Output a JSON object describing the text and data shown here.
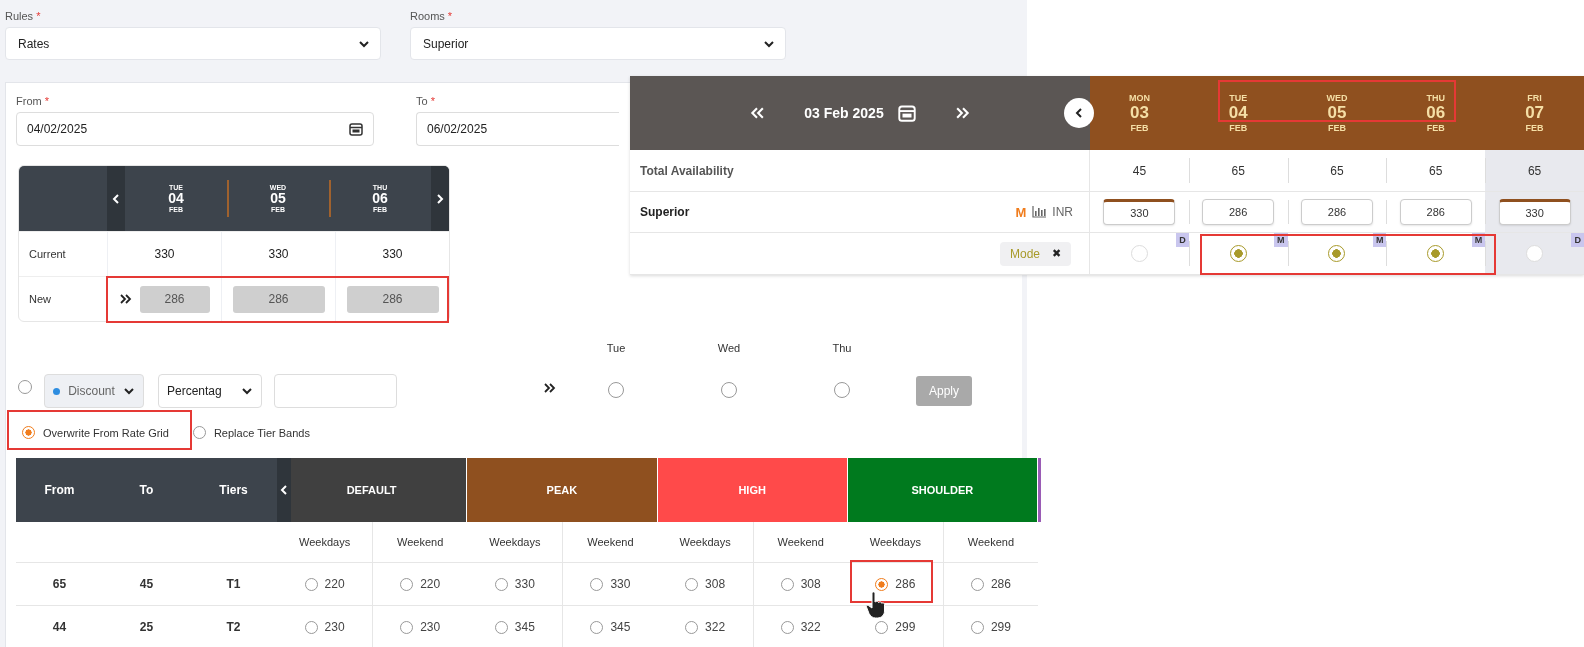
{
  "rules": {
    "label": "Rules",
    "required_mark": "*",
    "value": "Rates"
  },
  "rooms": {
    "label": "Rooms",
    "required_mark": "*",
    "value": "Superior"
  },
  "from": {
    "label": "From",
    "required_mark": "*",
    "value": "04/02/2025"
  },
  "to": {
    "label": "To",
    "required_mark": "*",
    "value": "06/02/2025"
  },
  "mini_grid": {
    "days": [
      {
        "dow": "TUE",
        "day": "04",
        "month": "FEB"
      },
      {
        "dow": "WED",
        "day": "05",
        "month": "FEB"
      },
      {
        "dow": "THU",
        "day": "06",
        "month": "FEB"
      }
    ],
    "current": {
      "label": "Current",
      "values": [
        "330",
        "330",
        "330"
      ]
    },
    "new": {
      "label": "New",
      "values": [
        "286",
        "286",
        "286"
      ]
    }
  },
  "adjust": {
    "selected": false,
    "type": "Discount",
    "method": "Percentag",
    "days": [
      {
        "label": "Tue",
        "selected": false
      },
      {
        "label": "Wed",
        "selected": false
      },
      {
        "label": "Thu",
        "selected": false
      }
    ],
    "apply": "Apply"
  },
  "modes": [
    {
      "label": "Overwrite From Rate Grid",
      "selected": true
    },
    {
      "label": "Replace Tier Bands",
      "selected": false
    }
  ],
  "tier_table": {
    "columns": [
      "From",
      "To",
      "Tiers"
    ],
    "bands": [
      {
        "name": "DEFAULT",
        "color": "#404040",
        "sub": [
          "Weekdays",
          "Weekend"
        ]
      },
      {
        "name": "PEAK",
        "color": "#8f501f",
        "sub": [
          "Weekdays",
          "Weekend"
        ]
      },
      {
        "name": "HIGH",
        "color": "#ff4a4a",
        "sub": [
          "Weekdays",
          "Weekend"
        ]
      },
      {
        "name": "SHOULDER",
        "color": "#007a1e",
        "sub": [
          "Weekdays",
          "Weekend"
        ]
      }
    ],
    "rows": [
      {
        "from": "65",
        "to": "45",
        "tier": "T1",
        "cells": [
          {
            "value": "220",
            "selected": false
          },
          {
            "value": "220",
            "selected": false
          },
          {
            "value": "330",
            "selected": false
          },
          {
            "value": "330",
            "selected": false
          },
          {
            "value": "308",
            "selected": false
          },
          {
            "value": "308",
            "selected": false
          },
          {
            "value": "286",
            "selected": true
          },
          {
            "value": "286",
            "selected": false
          }
        ]
      },
      {
        "from": "44",
        "to": "25",
        "tier": "T2",
        "cells": [
          {
            "value": "230",
            "selected": false
          },
          {
            "value": "230",
            "selected": false
          },
          {
            "value": "345",
            "selected": false
          },
          {
            "value": "345",
            "selected": false
          },
          {
            "value": "322",
            "selected": false
          },
          {
            "value": "322",
            "selected": false
          },
          {
            "value": "299",
            "selected": false
          },
          {
            "value": "299",
            "selected": false
          }
        ]
      }
    ]
  },
  "calendar": {
    "date": "03 Feb 2025",
    "days": [
      {
        "dow": "MON",
        "day": "03",
        "month": "FEB",
        "dimmed": false
      },
      {
        "dow": "TUE",
        "day": "04",
        "month": "FEB",
        "dimmed": false
      },
      {
        "dow": "WED",
        "day": "05",
        "month": "FEB",
        "dimmed": false
      },
      {
        "dow": "THU",
        "day": "06",
        "month": "FEB",
        "dimmed": false
      },
      {
        "dow": "FRI",
        "day": "07",
        "month": "FEB",
        "dimmed": true
      }
    ],
    "availability": {
      "label": "Total Availability",
      "values": [
        "45",
        "65",
        "65",
        "65",
        "65"
      ]
    },
    "room": {
      "name": "Superior",
      "mode_letter": "M",
      "currency": "INR",
      "rates": [
        {
          "value": "330",
          "marked": true
        },
        {
          "value": "286",
          "marked": false
        },
        {
          "value": "286",
          "marked": false
        },
        {
          "value": "286",
          "marked": false
        },
        {
          "value": "330",
          "marked": true
        }
      ]
    },
    "mode": {
      "label": "Mode",
      "close": "✖",
      "cells": [
        {
          "badge": "D",
          "selected": false
        },
        {
          "badge": "M",
          "selected": true
        },
        {
          "badge": "M",
          "selected": true
        },
        {
          "badge": "M",
          "selected": true
        },
        {
          "badge": "D",
          "selected": false
        }
      ]
    }
  }
}
